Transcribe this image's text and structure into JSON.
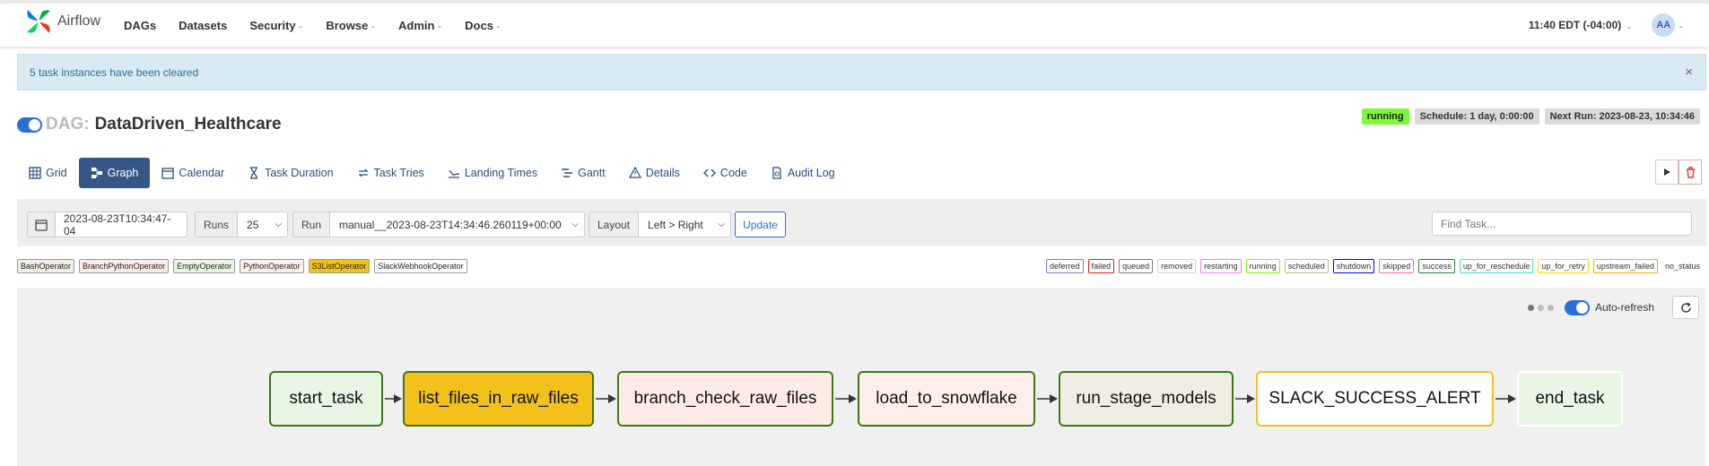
{
  "brand": {
    "name": "Airflow"
  },
  "nav": {
    "items": [
      {
        "label": "DAGs",
        "dropdown": false
      },
      {
        "label": "Datasets",
        "dropdown": false
      },
      {
        "label": "Security",
        "dropdown": true
      },
      {
        "label": "Browse",
        "dropdown": true
      },
      {
        "label": "Admin",
        "dropdown": true
      },
      {
        "label": "Docs",
        "dropdown": true
      }
    ],
    "clock": "11:40 EDT (-04:00)",
    "avatar": "AA"
  },
  "alert": {
    "message": "5 task instances have been cleared",
    "close": "×"
  },
  "dag": {
    "label": "DAG:",
    "name": "DataDriven_Healthcare",
    "status": "running",
    "schedule": "Schedule: 1 day, 0:00:00",
    "next_run": "Next Run: 2023-08-23, 10:34:46"
  },
  "tabs": [
    {
      "label": "Grid",
      "icon": "grid-icon"
    },
    {
      "label": "Graph",
      "icon": "graph-icon",
      "active": true
    },
    {
      "label": "Calendar",
      "icon": "calendar-icon"
    },
    {
      "label": "Task Duration",
      "icon": "hourglass-icon"
    },
    {
      "label": "Task Tries",
      "icon": "retry-icon"
    },
    {
      "label": "Landing Times",
      "icon": "landing-icon"
    },
    {
      "label": "Gantt",
      "icon": "gantt-icon"
    },
    {
      "label": "Details",
      "icon": "warning-icon"
    },
    {
      "label": "Code",
      "icon": "code-icon"
    },
    {
      "label": "Audit Log",
      "icon": "audit-log-icon"
    }
  ],
  "filters": {
    "date_value": "2023-08-23T10:34:47-04",
    "runs_label": "Runs",
    "runs_value": "25",
    "run_label": "Run",
    "run_value": "manual__2023-08-23T14:34:46.260119+00:00",
    "layout_label": "Layout",
    "layout_value": "Left > Right",
    "update_label": "Update",
    "find_placeholder": "Find Task..."
  },
  "operators": [
    {
      "label": "BashOperator",
      "color": "#f0eee4"
    },
    {
      "label": "BranchPythonOperator",
      "color": "#ffebe6"
    },
    {
      "label": "EmptyOperator",
      "color": "#e8f7e4"
    },
    {
      "label": "PythonOperator",
      "color": "#ffefeb"
    },
    {
      "label": "S3ListOperator",
      "color": "#f3c21a"
    },
    {
      "label": "SlackWebhookOperator",
      "color": "#ffffff"
    }
  ],
  "states": [
    {
      "label": "deferred",
      "color": "#9370db"
    },
    {
      "label": "failed",
      "color": "#e02020"
    },
    {
      "label": "queued",
      "color": "#808080"
    },
    {
      "label": "removed",
      "color": "#d3d3d3"
    },
    {
      "label": "restarting",
      "color": "#ee82ee"
    },
    {
      "label": "running",
      "color": "#7cfc00"
    },
    {
      "label": "scheduled",
      "color": "#d2b48c"
    },
    {
      "label": "shutdown",
      "color": "#0000ff"
    },
    {
      "label": "skipped",
      "color": "#ff69b4"
    },
    {
      "label": "success",
      "color": "#2e7d32"
    },
    {
      "label": "up_for_reschedule",
      "color": "#40e0d0"
    },
    {
      "label": "up_for_retry",
      "color": "#ffd700"
    },
    {
      "label": "upstream_failed",
      "color": "#ffa500"
    },
    {
      "label": "no_status",
      "color": null
    }
  ],
  "graph_controls": {
    "auto_refresh_label": "Auto-refresh"
  },
  "tasks": [
    {
      "label": "start_task",
      "fill": "#e8f7e4",
      "border": "#3c7a17"
    },
    {
      "label": "list_files_in_raw_files",
      "fill": "#f3c21a",
      "border": "#3c7a17"
    },
    {
      "label": "branch_check_raw_files",
      "fill": "#ffebe6",
      "border": "#3c7a17"
    },
    {
      "label": "load_to_snowflake",
      "fill": "#ffefeb",
      "border": "#3c7a17"
    },
    {
      "label": "run_stage_models",
      "fill": "#f0eee4",
      "border": "#3c7a17"
    },
    {
      "label": "SLACK_SUCCESS_ALERT",
      "fill": "#ffffff",
      "border": "#f0c419"
    },
    {
      "label": "end_task",
      "fill": "#e8f7e4",
      "border": "#ffffff"
    }
  ]
}
